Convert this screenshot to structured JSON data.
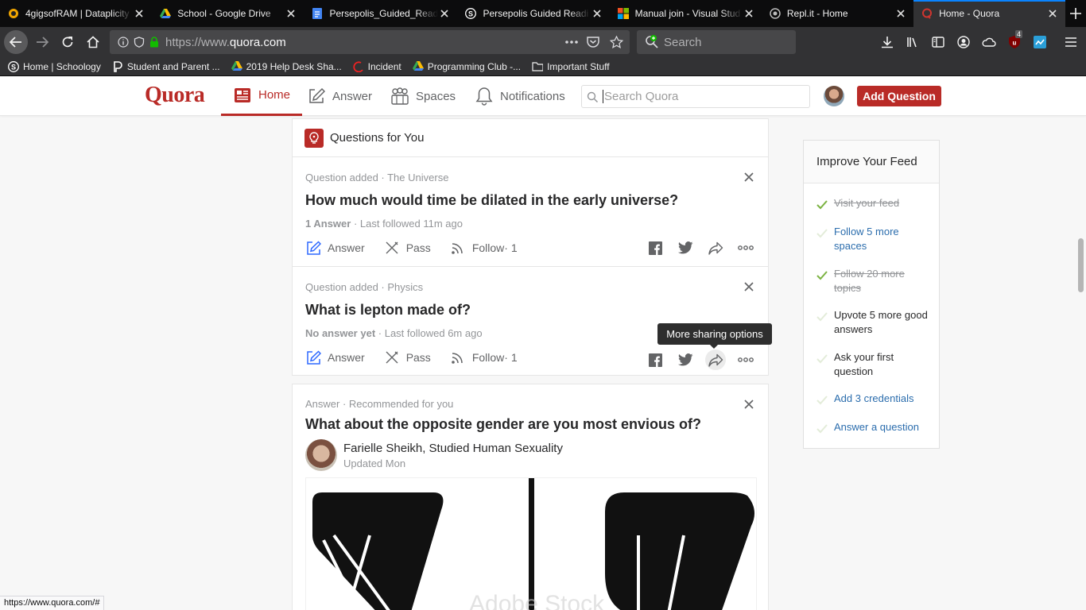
{
  "browser": {
    "tabs": [
      {
        "title": "4gigsofRAM | Dataplicity",
        "icon": "dataplicity-icon"
      },
      {
        "title": "School - Google Drive",
        "icon": "google-drive-icon"
      },
      {
        "title": "Persepolis_Guided_Readi",
        "icon": "google-docs-icon"
      },
      {
        "title": "Persepolis Guided Readi",
        "icon": "schoology-icon"
      },
      {
        "title": "Manual join - Visual Stud",
        "icon": "microsoft-icon"
      },
      {
        "title": "Repl.it - Home",
        "icon": "replit-icon"
      },
      {
        "title": "Home - Quora",
        "icon": "quora-icon"
      }
    ],
    "url_prefix": "https://www.",
    "url_domain": "quora.com",
    "search_placeholder": "Search",
    "addon_badge": "4",
    "bookmarks": [
      {
        "label": "Home | Schoology",
        "icon": "schoology-icon"
      },
      {
        "label": "Student and Parent ...",
        "icon": "powerschool-icon"
      },
      {
        "label": "2019 Help Desk Sha...",
        "icon": "google-drive-icon"
      },
      {
        "label": "Incident",
        "icon": "incident-icon"
      },
      {
        "label": "Programming Club -...",
        "icon": "google-drive-icon"
      },
      {
        "label": "Important Stuff",
        "icon": "folder-icon"
      }
    ],
    "status_url": "https://www.quora.com/#"
  },
  "header": {
    "logo": "Quora",
    "nav": {
      "home": "Home",
      "answer": "Answer",
      "spaces": "Spaces",
      "notifications": "Notifications"
    },
    "search_placeholder": "Search Quora",
    "add_question": "Add Question"
  },
  "feed": {
    "section_title": "Questions for You",
    "questions": [
      {
        "meta": "Question added · The Universe",
        "title": "How much would time be dilated in the early universe?",
        "answers": "1 Answer",
        "followed": " · Last followed 11m ago",
        "answer_label": "Answer",
        "pass_label": "Pass",
        "follow_label": "Follow",
        "follow_count": " · 1"
      },
      {
        "meta": "Question added · Physics",
        "title": "What is lepton made of?",
        "answers": "No answer yet",
        "followed": " · Last followed 6m ago",
        "answer_label": "Answer",
        "pass_label": "Pass",
        "follow_label": "Follow",
        "follow_count": " · 1"
      }
    ],
    "tooltip": "More sharing options",
    "answer_card": {
      "meta": "Answer · Recommended for you",
      "title": "What about the opposite gender are you most envious of?",
      "author": "Farielle Sheikh, Studied Human Sexuality",
      "updated": "Updated Mon",
      "watermark": "Adobe Stock"
    }
  },
  "sidebar": {
    "title": "Improve Your Feed",
    "tasks": [
      {
        "label": "Visit your feed",
        "state": "done"
      },
      {
        "label": "Follow 5 more spaces",
        "state": "link"
      },
      {
        "label": "Follow 20 more topics",
        "state": "done"
      },
      {
        "label": "Upvote 5 more good answers",
        "state": "plain"
      },
      {
        "label": "Ask your first question",
        "state": "plain"
      },
      {
        "label": "Add 3 credentials",
        "state": "link"
      },
      {
        "label": "Answer a question",
        "state": "link"
      }
    ]
  },
  "colors": {
    "brand": "#b92b27",
    "link": "#2b6dad",
    "check_done": "#7cb342",
    "browser_dark": "#0c0c0d"
  }
}
